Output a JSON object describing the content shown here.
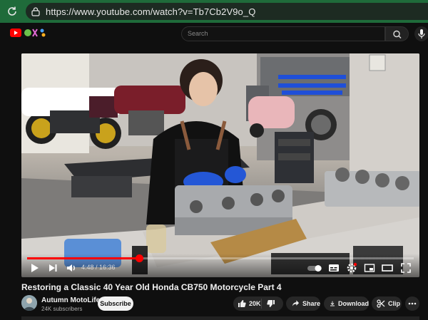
{
  "browser": {
    "url": "https://www.youtube.com/watch?v=Tb7Cb2V9o_Q"
  },
  "header": {
    "search_placeholder": "Search"
  },
  "player": {
    "current_time": "4:48",
    "duration": "16:36",
    "time_display": "4:48 / 16:36",
    "progress_fraction": 0.289
  },
  "video": {
    "title": "Restoring a Classic 40 Year Old Honda CB750 Motorcycle Part 4"
  },
  "channel": {
    "name": "Autumn MotoLife",
    "subscribers": "24K subscribers",
    "subscribe_label": "Subscribe"
  },
  "actions": {
    "likes": "20K",
    "share_label": "Share",
    "download_label": "Download",
    "clip_label": "Clip"
  },
  "colors": {
    "browser_bar": "#1f6b3a",
    "progress": "#ff0000",
    "page_bg": "#0f0f0f"
  }
}
